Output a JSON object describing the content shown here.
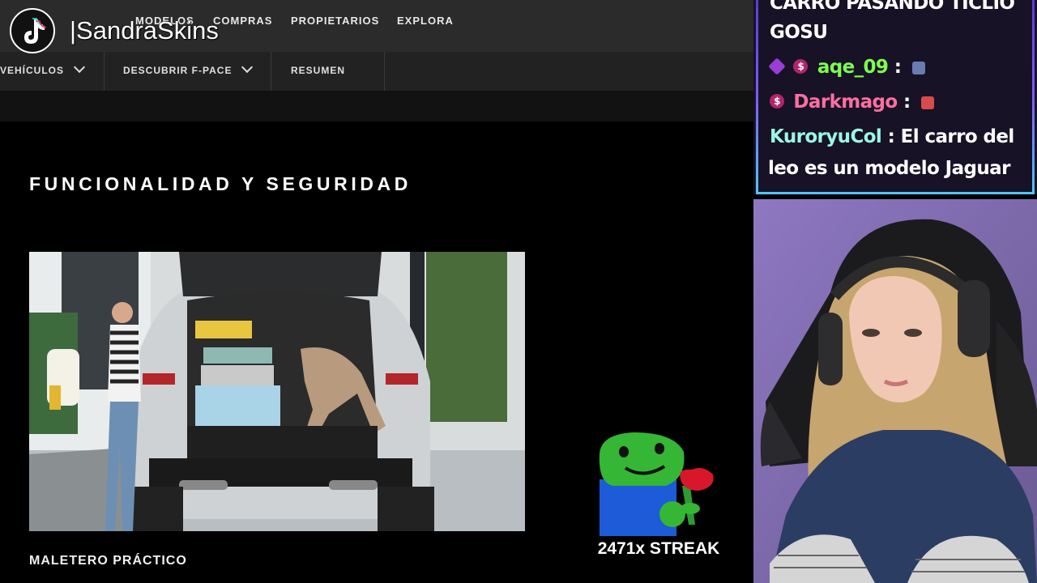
{
  "site": {
    "topnav": [
      "MODELOS",
      "COMPRAS",
      "PROPIETARIOS",
      "EXPLORA"
    ],
    "subnav": [
      {
        "label": "VEHÍCULOS",
        "has_dropdown": true
      },
      {
        "label": "DESCUBRIR F-PACE",
        "has_dropdown": true
      },
      {
        "label": "RESUMEN",
        "has_dropdown": false
      }
    ],
    "section_heading": "FUNCIONALIDAD Y SEGURIDAD",
    "feature_caption": "MALETERO PRÁCTICO"
  },
  "watermark": {
    "handle": "|SandraSkins"
  },
  "streak": {
    "label": "2471x STREAK"
  },
  "chat": {
    "messages": [
      {
        "user": "",
        "text": "CARRO PASANDO TICLIO"
      },
      {
        "user": "",
        "text": "GOSU"
      },
      {
        "user": "aqe_09",
        "user_color": "#7cff4f",
        "separator": ":",
        "text": "",
        "badges": [
          "cube",
          "sub"
        ]
      },
      {
        "user": "Darkmago",
        "user_color": "#ff6fa0",
        "separator": ":",
        "text": "",
        "badges": [
          "sub"
        ]
      },
      {
        "user": "KuroryuCol",
        "user_color": "#9cf7e4",
        "separator": ":",
        "text": "El carro del"
      },
      {
        "user": "",
        "text": "leo es un modelo Jaguar"
      }
    ]
  },
  "colors": {
    "nav_bg": "#2b2b2b",
    "chat_border": "#7d5cff",
    "chat_bg": "#171226"
  }
}
